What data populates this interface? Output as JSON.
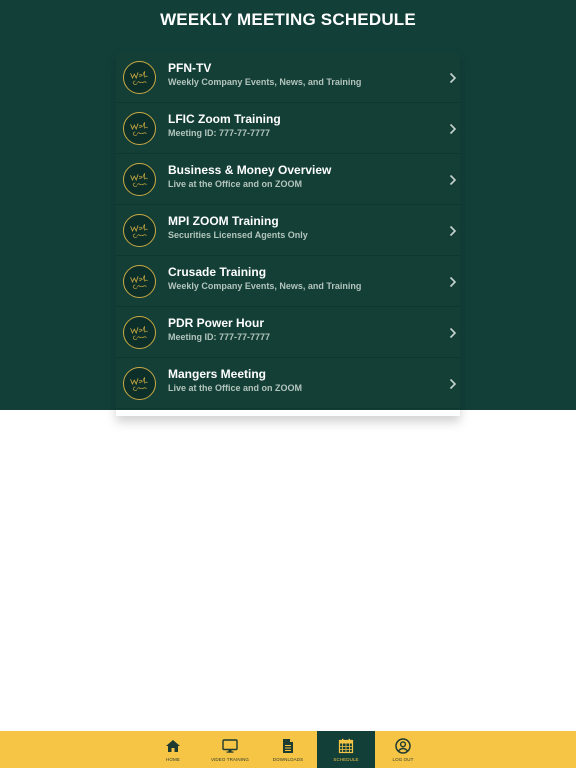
{
  "page_title": "WEEKLY MEETING SCHEDULE",
  "colors": {
    "panel": "#123f38",
    "row": "#133f37",
    "gold": "#c9a943",
    "tabbar": "#f6c545",
    "tab_active": "#123f38"
  },
  "meetings": [
    {
      "title": "PFN-TV",
      "subtitle": "Weekly Company Events, News, and Training",
      "icon": "wealth-logo-icon"
    },
    {
      "title": "LFIC Zoom Training",
      "subtitle": "Meeting ID: 777-77-7777",
      "icon": "wealth-logo-icon"
    },
    {
      "title": "Business & Money Overview",
      "subtitle": "Live at the Office and on ZOOM",
      "icon": "wealth-logo-icon"
    },
    {
      "title": "MPI ZOOM Training",
      "subtitle": "Securities Licensed Agents Only",
      "icon": "wealth-logo-icon"
    },
    {
      "title": "Crusade Training",
      "subtitle": "Weekly Company Events, News, and Training",
      "icon": "wealth-logo-icon"
    },
    {
      "title": "PDR Power Hour",
      "subtitle": "Meeting ID: 777-77-7777",
      "icon": "wealth-logo-icon"
    },
    {
      "title": "Mangers Meeting",
      "subtitle": "Live at the Office and on ZOOM",
      "icon": "wealth-logo-icon"
    }
  ],
  "tabs": [
    {
      "label": "HOME",
      "icon": "home-icon"
    },
    {
      "label": "VIDEO TRAINING",
      "icon": "monitor-icon"
    },
    {
      "label": "DOWNLOADS",
      "icon": "document-icon"
    },
    {
      "label": "SCHEDULE",
      "icon": "calendar-icon",
      "active": true
    },
    {
      "label": "LOG OUT",
      "icon": "user-circle-icon"
    }
  ]
}
